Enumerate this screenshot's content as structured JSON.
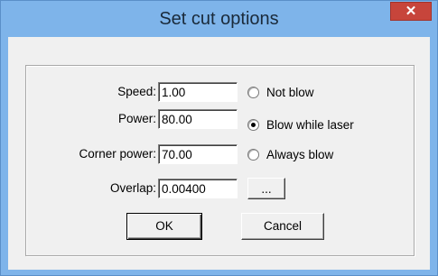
{
  "window": {
    "title": "Set cut options",
    "close_glyph": "✕"
  },
  "colors": {
    "frame": "#7eb4ea",
    "close_button": "#c7453b",
    "dialog_bg": "#f0f0f0"
  },
  "fields": {
    "speed": {
      "label": "Speed:",
      "value": "1.00"
    },
    "power": {
      "label": "Power:",
      "value": "80.00"
    },
    "corner_power": {
      "label": "Corner power:",
      "value": "70.00"
    },
    "overlap": {
      "label": "Overlap:",
      "value": "0.00400"
    }
  },
  "blow_mode": {
    "options": [
      {
        "label": "Not blow",
        "selected": false
      },
      {
        "label": "Blow while laser",
        "selected": true
      },
      {
        "label": "Always blow",
        "selected": false
      }
    ]
  },
  "buttons": {
    "browse": "...",
    "ok": "OK",
    "cancel": "Cancel"
  }
}
